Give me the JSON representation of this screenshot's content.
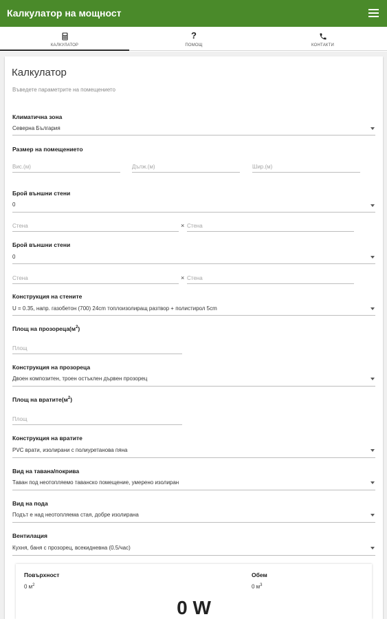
{
  "app": {
    "title": "Калкулатор на мощност"
  },
  "tabs": [
    {
      "label": "КАЛКУЛАТОР",
      "icon": "calculator-icon"
    },
    {
      "label": "ПОМОЩ",
      "icon": "help-icon"
    },
    {
      "label": "КОНТАКТИ",
      "icon": "phone-icon"
    }
  ],
  "form": {
    "title": "Калкулатор",
    "subtitle": "Въведете параметрите на помещението",
    "climate_zone": {
      "label": "Климатична зона",
      "value": "Северна България"
    },
    "room_size": {
      "label": "Размер на помещението",
      "height_ph": "Вис.(м)",
      "length_ph": "Дълж.(м)",
      "width_ph": "Шир.(м)"
    },
    "outer_walls_1": {
      "label": "Брой външни стени",
      "value": "0",
      "wall_a_ph": "Стена",
      "times": "×",
      "wall_b_ph": "Стена"
    },
    "outer_walls_2": {
      "label": "Брой външни стени",
      "value": "0",
      "wall_a_ph": "Стена",
      "times": "×",
      "wall_b_ph": "Стена"
    },
    "wall_construction": {
      "label": "Конструкция на стените",
      "value": "U = 0.35, напр. газобетон (700) 24cm топлоизолиращ разтвор + полистирол 5cm"
    },
    "window_area": {
      "label": "Площ на прозореца(м",
      "sup": "2",
      "close": ")",
      "ph": "Площ"
    },
    "window_construction": {
      "label": "Конструкция на прозореца",
      "value": "Двоен композитен, троен остъклен дървен прозорец"
    },
    "door_area": {
      "label": "Площ на вратите(м",
      "sup": "2",
      "close": ")",
      "ph": "Площ"
    },
    "door_construction": {
      "label": "Конструкция на вратите",
      "value": "PVC врати, изолирани с полиуретанова пяна"
    },
    "ceiling": {
      "label": "Вид на тавана/покрива",
      "value": "Таван под неотопляемо таванско помещение, умерено изолиран"
    },
    "floor": {
      "label": "Вид на пода",
      "value": "Подът е над неотопляема стая, добре изолирана"
    },
    "ventilation": {
      "label": "Вентилация",
      "value": "Кухня, баня с прозорец, всекидневна (0.5/час)"
    }
  },
  "result": {
    "surface_label": "Повърхност",
    "surface_value": "0 м",
    "surface_sup": "2",
    "volume_label": "Обем",
    "volume_value": "0 м",
    "volume_sup": "3",
    "power": "0 W"
  }
}
